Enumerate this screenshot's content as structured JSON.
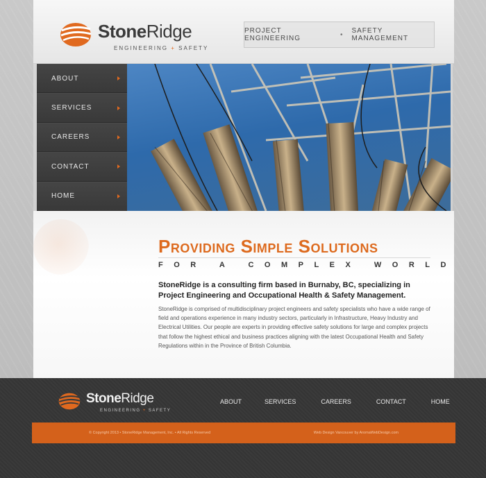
{
  "brand": {
    "name_part1": "Stone",
    "name_part2": "Ridge",
    "tagline_left": "ENGINEERING",
    "tagline_plus": "+",
    "tagline_right": "SAFETY",
    "accent_color": "#e0691f"
  },
  "header": {
    "links": [
      {
        "label": "PROJECT ENGINEERING"
      },
      {
        "label": "SAFETY MANAGEMENT"
      }
    ],
    "separator": "•"
  },
  "nav": {
    "items": [
      {
        "label": "ABOUT"
      },
      {
        "label": "SERVICES"
      },
      {
        "label": "CAREERS"
      },
      {
        "label": "CONTACT"
      },
      {
        "label": "HOME"
      }
    ]
  },
  "hero": {
    "subject": "electrical substation insulators photo"
  },
  "main": {
    "headline": "Providing Simple Solutions",
    "subheadline": "FOR A COMPLEX WORLD",
    "lead": "StoneRidge is a consulting firm based in Burnaby, BC, specializing in Project Engineering and Occupational Health & Safety Management.",
    "body": "StoneRidge is comprised of multidisciplinary project engineers and safety specialists who have a wide range of field and operations experience in many industry sectors, particularly in Infrastructure, Heavy Industry and Electrical Utilities. Our people are experts in providing effective safety solutions for large and complex projects that follow the highest ethical and business practices aligning with the latest Occupational Health and Safety Regulations within in the Province of British Columbia."
  },
  "footer": {
    "nav": [
      {
        "label": "ABOUT"
      },
      {
        "label": "SERVICES"
      },
      {
        "label": "CAREERS"
      },
      {
        "label": "CONTACT"
      },
      {
        "label": "HOME"
      }
    ],
    "copyright": "© Copyright 2013 • StoneRidge Management, Inc. • All Rights Reserved",
    "credit": "Web Design Vancouver by AromaWebDesign.com"
  }
}
